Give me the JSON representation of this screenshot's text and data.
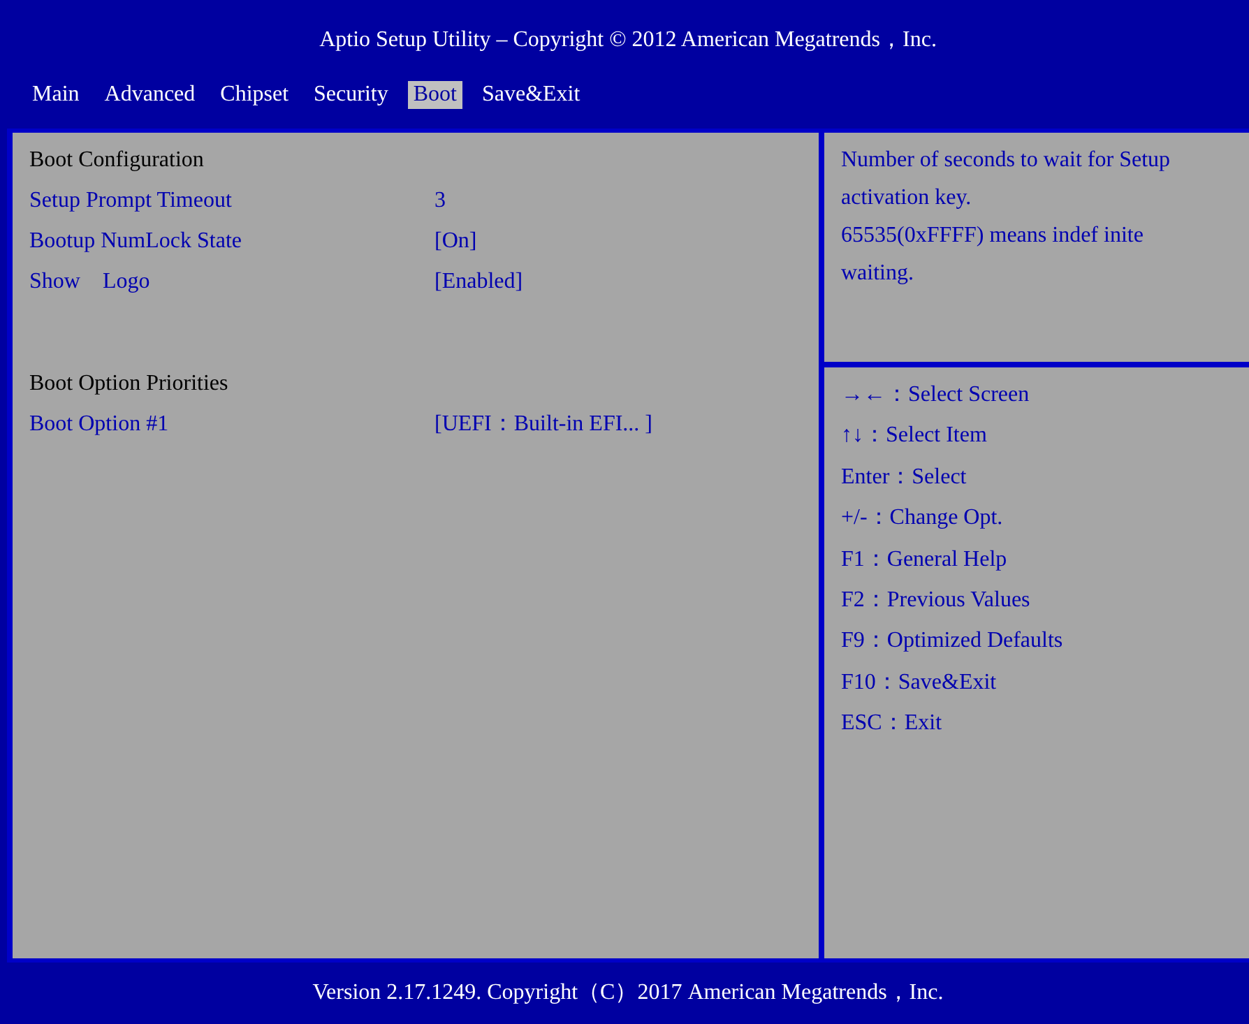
{
  "window": {
    "title": "Aptio Setup Utility – Copyright © 2012 American Megatrends，Inc."
  },
  "tabs": [
    {
      "label": "Main",
      "selected": false
    },
    {
      "label": "Advanced",
      "selected": false
    },
    {
      "label": "Chipset",
      "selected": false
    },
    {
      "label": "Security",
      "selected": false
    },
    {
      "label": "Boot",
      "selected": true
    },
    {
      "label": "Save&Exit",
      "selected": false
    }
  ],
  "settings": [
    {
      "kind": "heading",
      "label": "Boot Configuration"
    },
    {
      "kind": "setting",
      "label": "Setup Prompt Timeout",
      "value": "3"
    },
    {
      "kind": "setting",
      "label": "Bootup NumLock State",
      "value": "[On]"
    },
    {
      "kind": "setting",
      "label": "Show    Logo",
      "value": "[Enabled]"
    },
    {
      "kind": "heading",
      "label": "Boot Option Priorities"
    },
    {
      "kind": "setting",
      "label": "Boot Option #1",
      "value": "[UEFI：Built-in EFI... ]"
    }
  ],
  "help": [
    "Number of seconds to wait for Setup activation key.",
    "65535(0xFFFF) means indef inite waiting."
  ],
  "key_hints": [
    "→←：Select Screen",
    "↑↓：Select Item",
    "Enter：Select",
    "+/-：Change Opt.",
    "F1：General Help",
    "F2：Previous Values",
    "F9：Optimized Defaults",
    "F10：Save&Exit",
    "ESC：Exit"
  ],
  "status_bar": "Version 2.17.1249. Copyright（C）2017 American Megatrends，Inc."
}
